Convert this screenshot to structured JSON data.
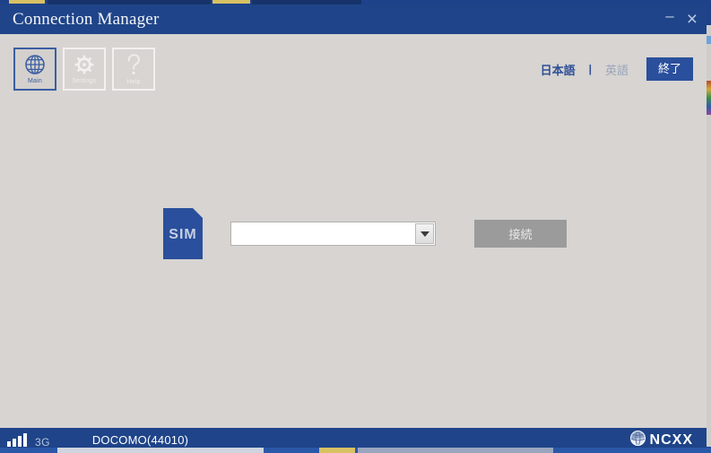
{
  "window": {
    "title": "Connection Manager",
    "controls": {
      "minimize_label": "–",
      "minimize_name": "minimize",
      "close_label": "×",
      "close_name": "close"
    }
  },
  "toolbar": {
    "buttons": [
      {
        "id": "main",
        "label": "Main",
        "icon": "globe-icon",
        "state": "active"
      },
      {
        "id": "settings",
        "label": "Settings",
        "icon": "gear-icon",
        "state": "disabled"
      },
      {
        "id": "help",
        "label": "Help",
        "icon": "question-icon",
        "state": "disabled"
      }
    ],
    "language": {
      "japanese_label": "日本語",
      "separator": "|",
      "english_label": "英語",
      "selected": "日本語"
    },
    "exit_label": "終了"
  },
  "main": {
    "sim_label": "SIM",
    "profile_select": {
      "value": "",
      "placeholder": ""
    },
    "connect_label": "接続",
    "connect_enabled": false
  },
  "status": {
    "signal_bars": 4,
    "network_type": "3G",
    "carrier": "DOCOMO(44010)",
    "brand": "NCXX"
  },
  "colors": {
    "titlebar_blue": "#1f4489",
    "accent_blue": "#2a4f9c",
    "window_bg": "#d7d4d1",
    "disabled_gray": "#9b9b9b",
    "divider_white": "#ffffff"
  }
}
